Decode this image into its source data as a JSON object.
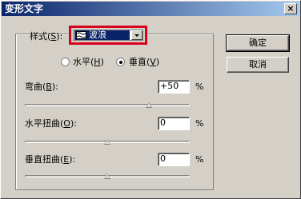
{
  "window": {
    "title": "变形文字",
    "close_symbol": "×"
  },
  "style": {
    "label": "样式(",
    "label_key": "S",
    "label_tail": "):",
    "selected_value": "波浪",
    "icon": "wave-icon",
    "highlight_color": "#d9001b"
  },
  "orientation": {
    "horizontal_label": "水平(",
    "horizontal_key": "H",
    "horizontal_tail": ")",
    "vertical_label": "垂直(",
    "vertical_key": "V",
    "vertical_tail": ")",
    "selected": "vertical"
  },
  "bend": {
    "label": "弯曲(",
    "key": "B",
    "tail": "):",
    "value": "+50",
    "unit": "%",
    "slider_value": 50
  },
  "horizontal_distortion": {
    "label": "水平扭曲(",
    "key": "O",
    "tail": "):",
    "value": "0",
    "unit": "%",
    "slider_value": 0
  },
  "vertical_distortion": {
    "label": "垂直扭曲(",
    "key": "E",
    "tail": "):",
    "value": "0",
    "unit": "%",
    "slider_value": 0
  },
  "buttons": {
    "ok": "确定",
    "cancel": "取消"
  }
}
